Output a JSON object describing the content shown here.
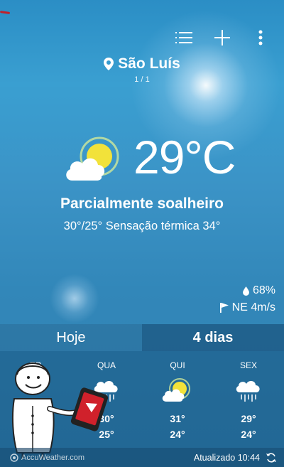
{
  "location": {
    "city": "São Luís",
    "page": "1 / 1"
  },
  "current": {
    "temperature": "29°C",
    "condition": "Parcialmente soalheiro",
    "hilo_feels": "30°/25° Sensação térmica 34°",
    "icon": "partly-sunny-icon"
  },
  "stats": {
    "humidity": "68%",
    "wind": "NE 4m/s"
  },
  "tabs": {
    "today": "Hoje",
    "four_days": "4 dias"
  },
  "forecast": [
    {
      "day": "ER",
      "icon": "rain-icon",
      "high": "",
      "low": ""
    },
    {
      "day": "QUA",
      "icon": "rain-icon",
      "high": "30°",
      "low": "25°"
    },
    {
      "day": "QUI",
      "icon": "partly-sunny-icon",
      "high": "31°",
      "low": "24°"
    },
    {
      "day": "SEX",
      "icon": "rain-icon",
      "high": "29°",
      "low": "24°"
    }
  ],
  "footer": {
    "brand": "AccuWeather.com",
    "updated": "Atualizado 10:44"
  },
  "colors": {
    "sky": "#3a9fd1",
    "sun": "#f2e23a",
    "badge_red": "#d0212b"
  }
}
